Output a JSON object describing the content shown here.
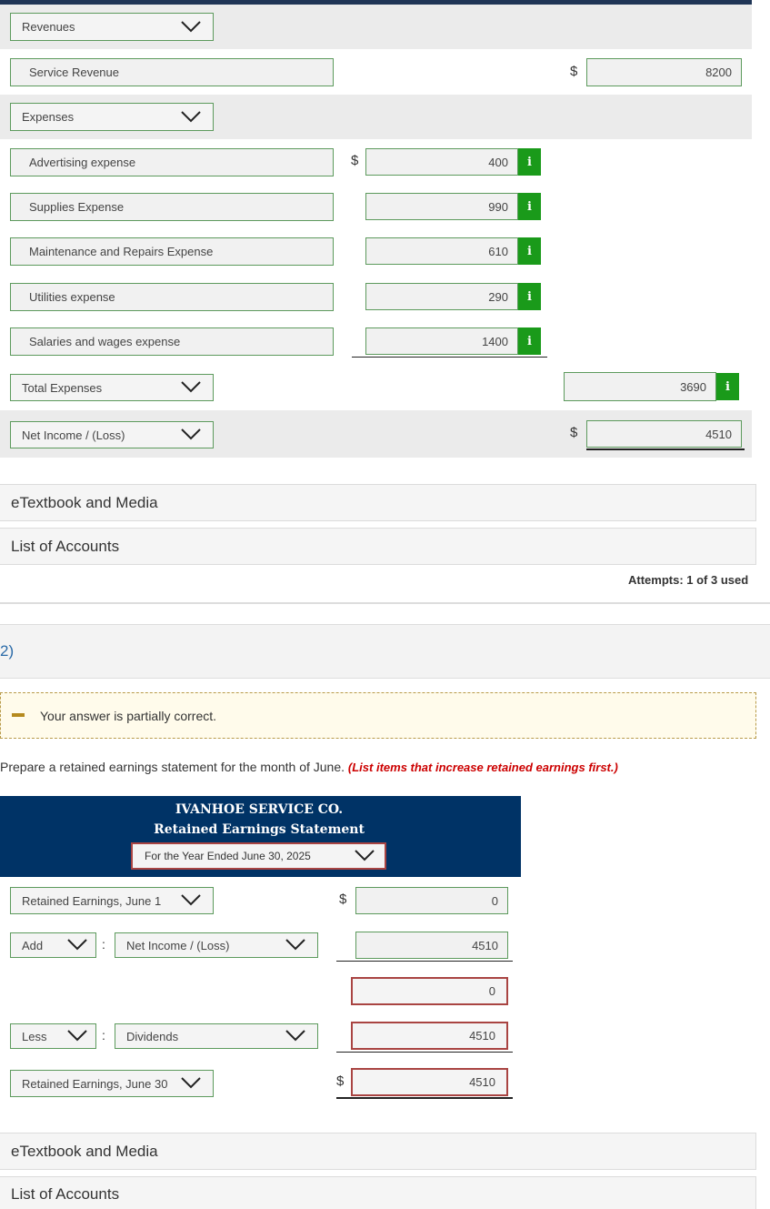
{
  "income": {
    "revenues_select": "Revenues",
    "service_revenue_label": "Service Revenue",
    "service_revenue_value": "8200",
    "expenses_select": "Expenses",
    "expense_items": [
      {
        "label": "Advertising expense",
        "value": "400"
      },
      {
        "label": "Supplies Expense",
        "value": "990"
      },
      {
        "label": "Maintenance and Repairs Expense",
        "value": "610"
      },
      {
        "label": "Utilities expense",
        "value": "290"
      },
      {
        "label": "Salaries and wages expense",
        "value": "1400"
      }
    ],
    "total_expenses_select": "Total Expenses",
    "total_expenses_value": "3690",
    "net_income_select": "Net Income / (Loss)",
    "net_income_value": "4510"
  },
  "symbols": {
    "dollar": "$",
    "colon": ":",
    "info": "i"
  },
  "links": {
    "etextbook": "eTextbook and Media",
    "accounts": "List of Accounts"
  },
  "attempts": "Attempts: 1 of 3 used",
  "question_number": "2)",
  "feedback": "Your answer is partially correct.",
  "instruction_main": "Prepare a retained earnings statement for the month of June.",
  "instruction_note": "(List items that increase retained earnings first.)",
  "statement": {
    "company": "IVANHOE SERVICE CO.",
    "title": "Retained Earnings Statement",
    "period": "For the Year Ended June 30, 2025",
    "re_begin_select": "Retained Earnings, June 1",
    "re_begin_value": "0",
    "add_select": "Add",
    "add_item_select": "Net Income / (Loss)",
    "add_value": "4510",
    "subtotal_value": "0",
    "less_select": "Less",
    "less_item_select": "Dividends",
    "less_value": "4510",
    "re_end_select": "Retained Earnings, June 30",
    "re_end_value": "4510"
  },
  "colors": {
    "header_navy": "#003366",
    "info_green": "#1a9a1a",
    "error_red": "#a94442",
    "note_red": "#cc0000"
  }
}
